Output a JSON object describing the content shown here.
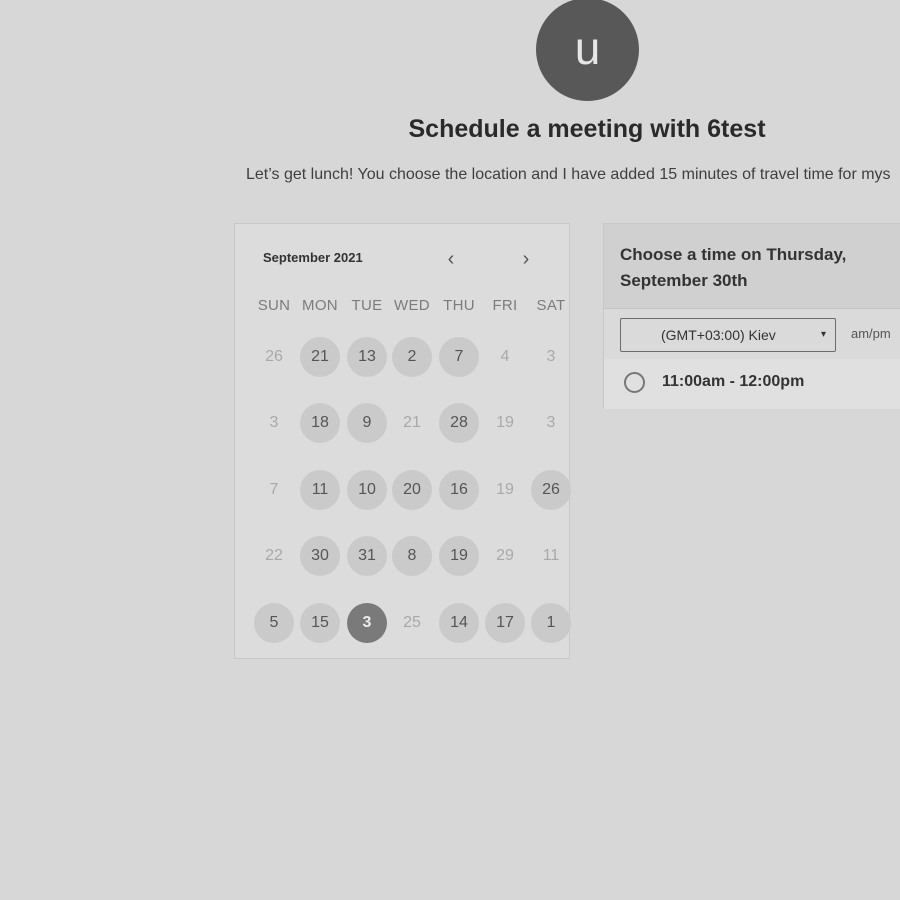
{
  "host": {
    "avatar_letter": "u",
    "title": "Schedule a meeting with 6test",
    "description": "Let’s get lunch! You choose the location and I have added 15 minutes of travel time for mys"
  },
  "calendar": {
    "month_label": "September 2021",
    "prev_icon": "‹",
    "next_icon": "›",
    "weekdays": [
      "SUN",
      "MON",
      "TUE",
      "WED",
      "THU",
      "FRI",
      "SAT"
    ],
    "weeks": [
      [
        {
          "d": "26",
          "s": "unavailable"
        },
        {
          "d": "21",
          "s": "available"
        },
        {
          "d": "13",
          "s": "available"
        },
        {
          "d": "2",
          "s": "available"
        },
        {
          "d": "7",
          "s": "available"
        },
        {
          "d": "4",
          "s": "unavailable"
        },
        {
          "d": "3",
          "s": "unavailable"
        }
      ],
      [
        {
          "d": "3",
          "s": "unavailable"
        },
        {
          "d": "18",
          "s": "available"
        },
        {
          "d": "9",
          "s": "available"
        },
        {
          "d": "21",
          "s": "unavailable"
        },
        {
          "d": "28",
          "s": "available"
        },
        {
          "d": "19",
          "s": "unavailable"
        },
        {
          "d": "3",
          "s": "unavailable"
        }
      ],
      [
        {
          "d": "7",
          "s": "unavailable"
        },
        {
          "d": "11",
          "s": "available"
        },
        {
          "d": "10",
          "s": "available"
        },
        {
          "d": "20",
          "s": "available"
        },
        {
          "d": "16",
          "s": "available"
        },
        {
          "d": "19",
          "s": "unavailable"
        },
        {
          "d": "26",
          "s": "available"
        }
      ],
      [
        {
          "d": "22",
          "s": "unavailable"
        },
        {
          "d": "30",
          "s": "available"
        },
        {
          "d": "31",
          "s": "available"
        },
        {
          "d": "8",
          "s": "available"
        },
        {
          "d": "19",
          "s": "available"
        },
        {
          "d": "29",
          "s": "unavailable"
        },
        {
          "d": "11",
          "s": "unavailable"
        }
      ],
      [
        {
          "d": "5",
          "s": "available"
        },
        {
          "d": "15",
          "s": "available"
        },
        {
          "d": "3",
          "s": "selected"
        },
        {
          "d": "25",
          "s": "unavailable"
        },
        {
          "d": "14",
          "s": "available"
        },
        {
          "d": "17",
          "s": "available"
        },
        {
          "d": "1",
          "s": "available"
        }
      ]
    ]
  },
  "time_panel": {
    "heading": "Choose a time on Thursday, September 30th",
    "timezone": "(GMT+03:00) Kiev",
    "timezone_caret": "▾",
    "ampm_label": "am/pm",
    "slots": [
      {
        "label": "11:00am - 12:00pm",
        "selected": false
      }
    ]
  }
}
